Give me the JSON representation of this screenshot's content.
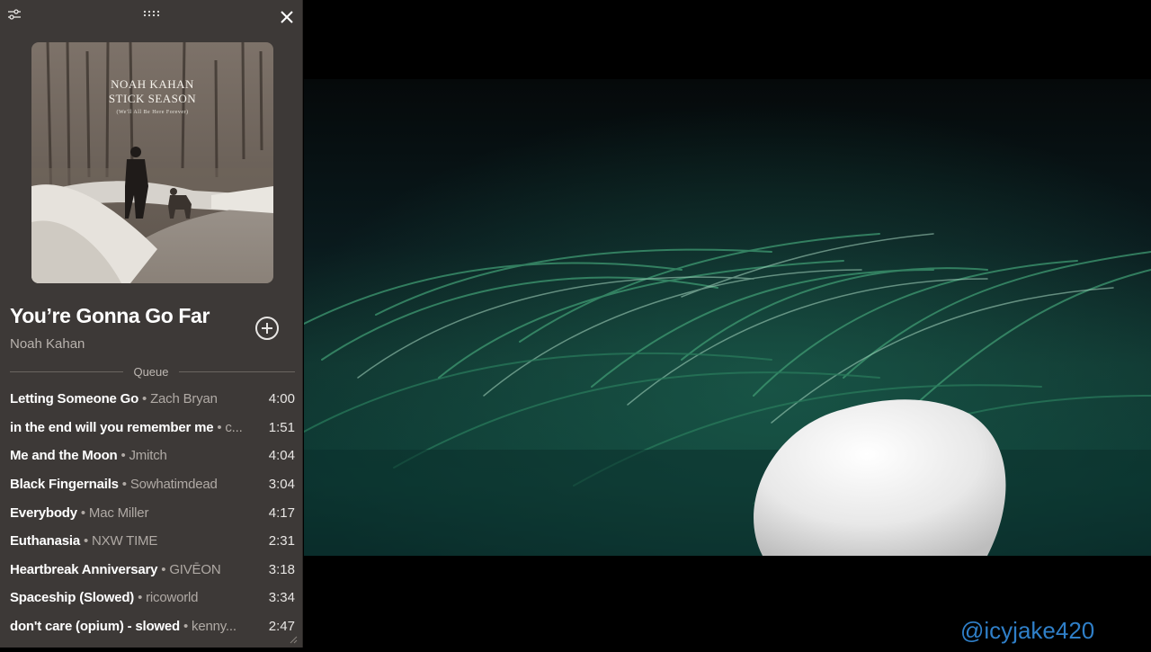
{
  "player": {
    "album": {
      "artist_text": "NOAH KAHAN",
      "title_text": "STICK SEASON",
      "subtitle_text": "(We'll All Be Here Forever)"
    },
    "track": {
      "title": "You’re Gonna Go Far",
      "artist": "Noah Kahan"
    },
    "queue_label": "Queue",
    "queue": [
      {
        "title": "Letting Someone Go",
        "artist": "Zach Bryan",
        "duration": "4:00"
      },
      {
        "title": "in the end will you remember me",
        "artist": "c...",
        "duration": "1:51"
      },
      {
        "title": "Me and the Moon",
        "artist": "Jmitch",
        "duration": "4:04"
      },
      {
        "title": "Black Fingernails",
        "artist": "Sowhatimdead",
        "duration": "3:04"
      },
      {
        "title": "Everybody",
        "artist": "Mac Miller",
        "duration": "4:17"
      },
      {
        "title": "Euthanasia",
        "artist": "NXW TIME",
        "duration": "2:31"
      },
      {
        "title": "Heartbreak Anniversary",
        "artist": "GIVĒON",
        "duration": "3:18"
      },
      {
        "title": "Spaceship (Slowed)",
        "artist": "ricoworld",
        "duration": "3:34"
      },
      {
        "title": "don't care (opium) - slowed",
        "artist": "kenny...",
        "duration": "2:47"
      }
    ],
    "separator": " • "
  },
  "watermark": "@icyjake420",
  "colors": {
    "panel_bg": "#3d3937",
    "text_primary": "#ffffff",
    "text_secondary": "#b0aaa5",
    "watermark": "#2f7fc8"
  },
  "icons": [
    "sliders-icon",
    "drag-handle-icon",
    "close-icon",
    "add-circle-icon",
    "resize-grip-icon"
  ]
}
